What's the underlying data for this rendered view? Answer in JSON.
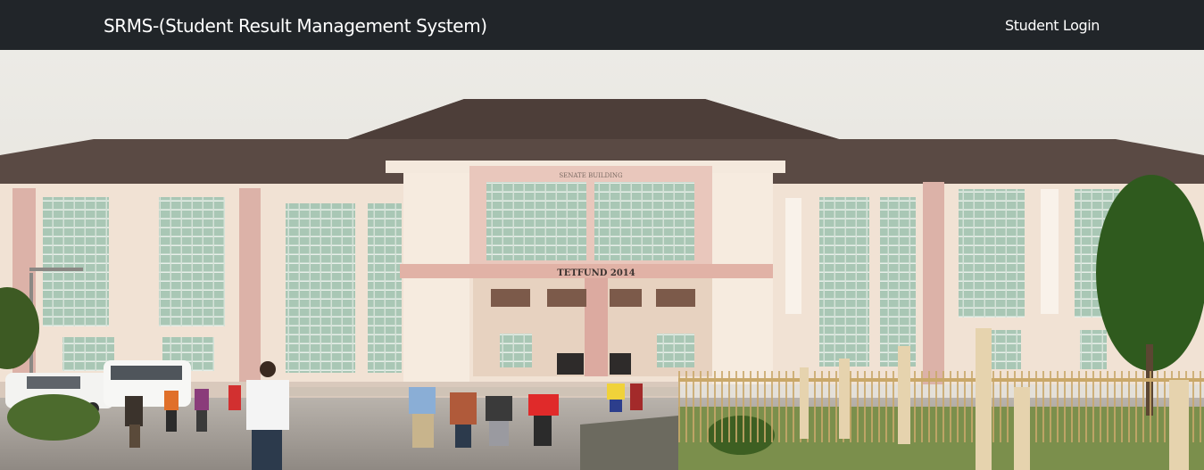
{
  "navbar": {
    "brand": "SRMS-(Student Result Management System)",
    "login_link": "Student Login",
    "background": "#212529"
  },
  "hero": {
    "image_subject": "senate-building-photo",
    "building_sign": "SENATE BUILDING",
    "building_plaque": "TETFUND 2014"
  }
}
